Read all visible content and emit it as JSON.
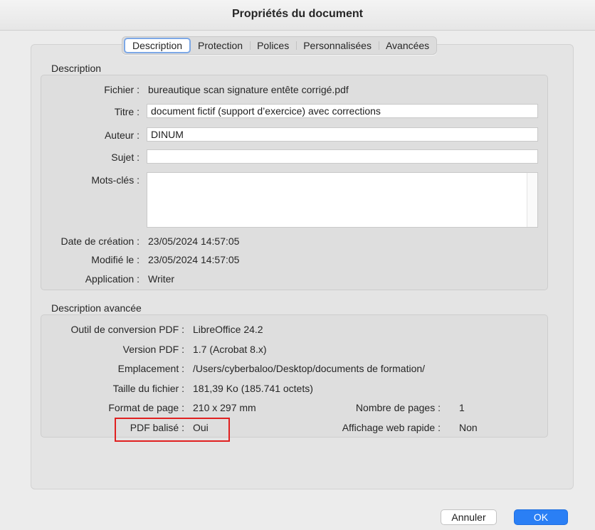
{
  "window": {
    "title": "Propriétés du document"
  },
  "tabs": [
    {
      "label": "Description",
      "active": true
    },
    {
      "label": "Protection",
      "active": false
    },
    {
      "label": "Polices",
      "active": false
    },
    {
      "label": "Personnalisées",
      "active": false
    },
    {
      "label": "Avancées",
      "active": false
    }
  ],
  "description": {
    "heading": "Description",
    "file_label": "Fichier :",
    "file_value": "bureautique scan signature entête corrigé.pdf",
    "title_label": "Titre :",
    "title_value": "document fictif (support d’exercice) avec corrections",
    "author_label": "Auteur :",
    "author_value": "DINUM",
    "subject_label": "Sujet :",
    "subject_value": "",
    "keywords_label": "Mots-clés :",
    "keywords_value": "",
    "created_label": "Date de création :",
    "created_value": "23/05/2024 14:57:05",
    "modified_label": "Modifié le :",
    "modified_value": "23/05/2024 14:57:05",
    "application_label": "Application :",
    "application_value": "Writer"
  },
  "advanced": {
    "heading": "Description avancée",
    "converter_label": "Outil de conversion PDF :",
    "converter_value": "LibreOffice 24.2",
    "pdf_version_label": "Version PDF :",
    "pdf_version_value": "1.7 (Acrobat 8.x)",
    "location_label": "Emplacement :",
    "location_value": "/Users/cyberbaloo/Desktop/documents de formation/",
    "size_label": "Taille du fichier :",
    "size_value": "181,39 Ko (185.741 octets)",
    "page_format_label": "Format de page :",
    "page_format_value": "210 x 297 mm",
    "page_count_label": "Nombre de pages :",
    "page_count_value": "1",
    "tagged_label": "PDF balisé :",
    "tagged_value": "Oui",
    "fast_web_label": "Affichage web rapide :",
    "fast_web_value": "Non"
  },
  "buttons": {
    "cancel": "Annuler",
    "ok": "OK"
  },
  "colors": {
    "accent": "#2a7ff5",
    "highlight": "#e02020"
  }
}
